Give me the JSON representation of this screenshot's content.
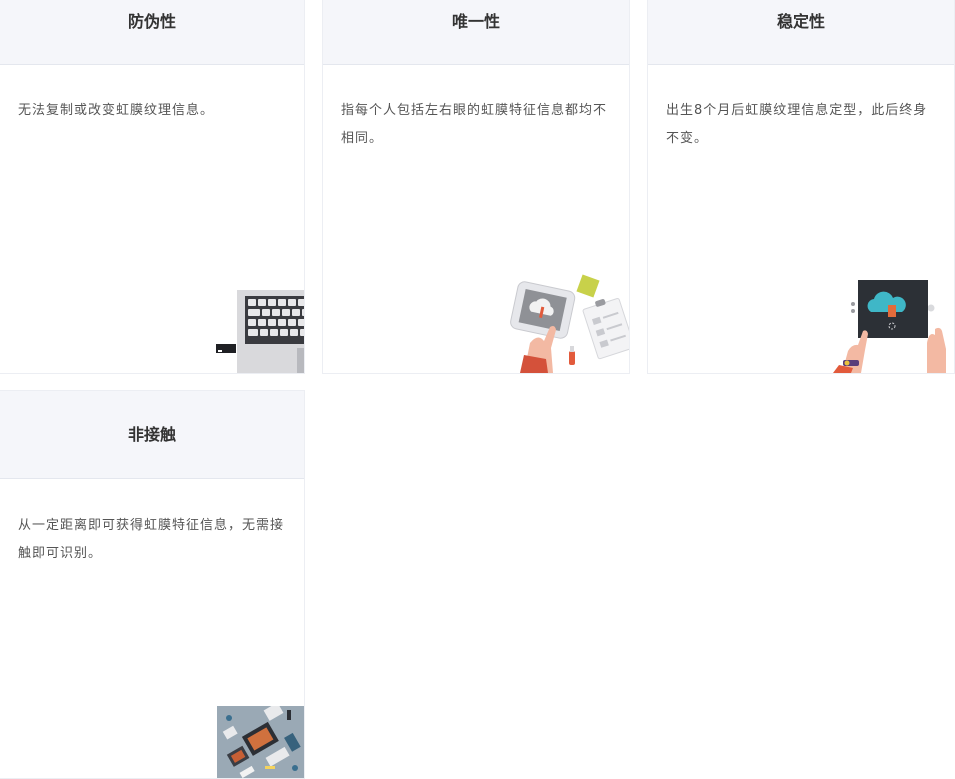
{
  "cards": [
    {
      "title": "防伪性",
      "text": "无法复制或改变虹膜纹理信息。",
      "illustration": "laptop-keyboard-icon"
    },
    {
      "title": "唯一性",
      "text": "指每个人包括左右眼的虹膜特征信息都均不相同。",
      "illustration": "tablet-cloud-icon"
    },
    {
      "title": "稳定性",
      "text": "出生8个月后虹膜纹理信息定型，此后终身不变。",
      "illustration": "cloud-upload-tablet-icon"
    },
    {
      "title": "非接触",
      "text": "从一定距离即可获得虹膜特征信息，无需接触即可识别。",
      "illustration": "isometric-devices-icon"
    }
  ],
  "colors": {
    "header_bg": "#f5f6fa",
    "border": "#e4e7ee",
    "title": "#333333",
    "body_text": "#555555"
  }
}
